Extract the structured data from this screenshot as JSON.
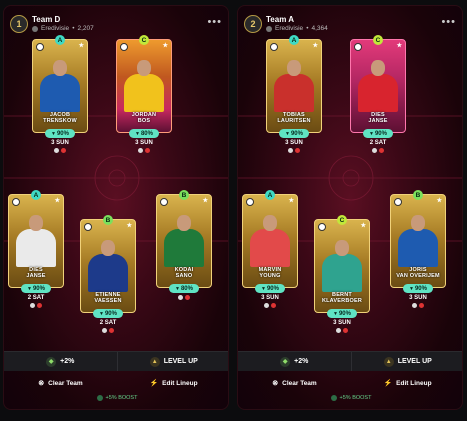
{
  "teams": [
    {
      "name": "Team D",
      "logo_glyph": "1",
      "league": "Eredivisie",
      "count": "2,207",
      "players": [
        {
          "rarity": "A",
          "rarity_class": "a",
          "card_style": "gold",
          "name_line1": "JACOB",
          "name_line2": "TRENSKOW",
          "pct": "90%",
          "status": "3 SUN",
          "jersey": "#1e5bb0"
        },
        {
          "rarity": "C",
          "rarity_class": "c",
          "card_style": "pinkstar",
          "name_line1": "JORDAN",
          "name_line2": "BOS",
          "pct": "80%",
          "status": "3 SUN",
          "jersey": "#f1c21c"
        },
        {
          "rarity": "A",
          "rarity_class": "a",
          "card_style": "gold",
          "name_line1": "DIES",
          "name_line2": "JANSE",
          "pct": "90%",
          "status": "2 SAT",
          "jersey": "#eaeaea"
        },
        {
          "rarity": "B",
          "rarity_class": "b",
          "card_style": "gold",
          "name_line1": "ETIENNE",
          "name_line2": "VAESSEN",
          "pct": "90%",
          "status": "2 SAT",
          "jersey": "#1d3a8a"
        },
        {
          "rarity": "B",
          "rarity_class": "b",
          "card_style": "gold",
          "name_line1": "KODAI",
          "name_line2": "SANO",
          "pct": "80%",
          "status": "",
          "jersey": "#1f7a3a"
        }
      ],
      "boost_percent": "+2%",
      "level_up": "LEVEL UP",
      "clear_team": "Clear Team",
      "edit_lineup": "Edit Lineup",
      "boost_text": "+5% BOOST"
    },
    {
      "name": "Team A",
      "logo_glyph": "2",
      "league": "Eredivisie",
      "count": "4,364",
      "players": [
        {
          "rarity": "A",
          "rarity_class": "a",
          "card_style": "gold",
          "name_line1": "TOBIAS",
          "name_line2": "LAURITSEN",
          "pct": "90%",
          "status": "3 SUN",
          "jersey": "#c9302c"
        },
        {
          "rarity": "C",
          "rarity_class": "c",
          "card_style": "pink",
          "name_line1": "DIES",
          "name_line2": "JANSE",
          "pct": "90%",
          "status": "2 SAT",
          "jersey": "#d8242e"
        },
        {
          "rarity": "A",
          "rarity_class": "a",
          "card_style": "gold",
          "name_line1": "MARVIN",
          "name_line2": "YOUNG",
          "pct": "90%",
          "status": "3 SUN",
          "jersey": "#e24a4a"
        },
        {
          "rarity": "C",
          "rarity_class": "c",
          "card_style": "gold",
          "name_line1": "BERNT",
          "name_line2": "KLAVERBOER",
          "pct": "90%",
          "status": "3 SUN",
          "jersey": "#2fa38f"
        },
        {
          "rarity": "B",
          "rarity_class": "b",
          "card_style": "gold",
          "name_line1": "JORIS",
          "name_line2": "VAN OVERIJEM",
          "pct": "90%",
          "status": "3 SUN",
          "jersey": "#1e5bb0"
        }
      ],
      "boost_percent": "+2%",
      "level_up": "LEVEL UP",
      "clear_team": "Clear Team",
      "edit_lineup": "Edit Lineup",
      "boost_text": "+5% BOOST"
    }
  ],
  "icons": {
    "menu": "more-dots-icon",
    "clear": "close-circle-icon",
    "edit": "lightning-icon",
    "level_up": "arrow-up-icon"
  }
}
